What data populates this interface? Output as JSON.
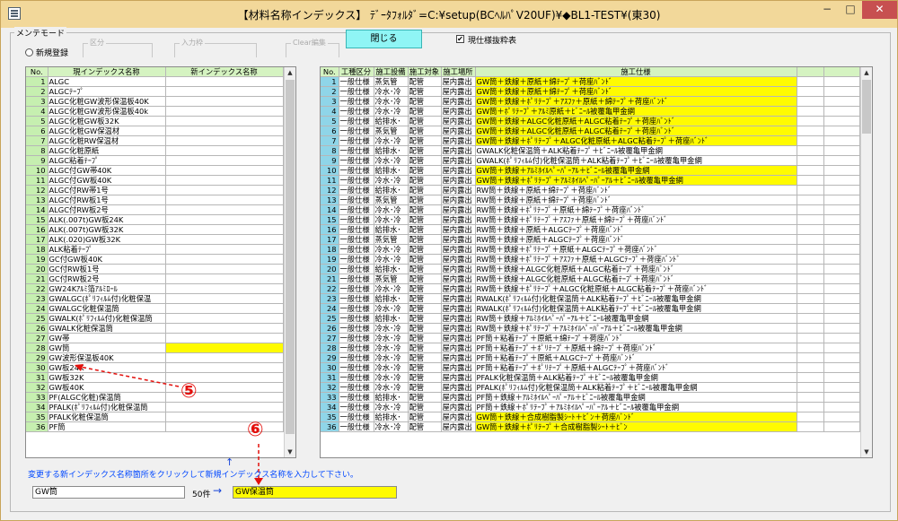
{
  "window": {
    "title": "【材料名称インデックス】 ﾃﾞｰﾀﾌｫﾙﾀﾞ=C:¥setup(BCﾍﾙﾊﾟV20UF)¥◆BL1-TEST¥(東30)",
    "min": "−",
    "max": "□",
    "close": "✕"
  },
  "mode": {
    "legend": "メンテモード",
    "new_label": "新規登録",
    "section_label": "区分",
    "input_label": "入力枠",
    "clear_label": "Clear編集"
  },
  "toolbar": {
    "close_label": "閉じる",
    "checkbox_label": "現仕様抜粋表",
    "checkbox_checked": "✔"
  },
  "left_table": {
    "headers": [
      "No.",
      "現インデックス名称",
      "新インデックス名称"
    ],
    "rows": [
      {
        "no": "1",
        "name": "ALGC"
      },
      {
        "no": "2",
        "name": "ALGCﾃｰﾌﾟ"
      },
      {
        "no": "3",
        "name": "ALGC化粧GW波形保温板40K"
      },
      {
        "no": "4",
        "name": "ALGC化粧GW波形保温板40k"
      },
      {
        "no": "5",
        "name": "ALGC化粧GW板32K"
      },
      {
        "no": "6",
        "name": "ALGC化粧GW保温材"
      },
      {
        "no": "7",
        "name": "ALGC化粧RW保温材"
      },
      {
        "no": "8",
        "name": "ALGC化粧原紙"
      },
      {
        "no": "9",
        "name": "ALGC粘着ﾃｰﾌﾟ"
      },
      {
        "no": "10",
        "name": "ALGC付GW帯40K"
      },
      {
        "no": "11",
        "name": "ALGC付GW板40K"
      },
      {
        "no": "12",
        "name": "ALGC付RW帯1号"
      },
      {
        "no": "13",
        "name": "ALGC付RW板1号"
      },
      {
        "no": "14",
        "name": "ALGC付RW板2号"
      },
      {
        "no": "15",
        "name": "ALK(.007t)GW板24K"
      },
      {
        "no": "16",
        "name": "ALK(.007t)GW板32K"
      },
      {
        "no": "17",
        "name": "ALK(.020)GW板32K"
      },
      {
        "no": "18",
        "name": "ALK粘着ﾃｰﾌﾟ"
      },
      {
        "no": "19",
        "name": "GC付GW板40K"
      },
      {
        "no": "20",
        "name": "GC付RW板1号"
      },
      {
        "no": "21",
        "name": "GC付RW板2号"
      },
      {
        "no": "22",
        "name": "GW24Kｱﾙﾐ箔ｱﾙﾐﾛｰﾙ"
      },
      {
        "no": "23",
        "name": "GWALGC(ﾎﾟﾘﾌｨﾙﾑ付)化粧保温"
      },
      {
        "no": "24",
        "name": "GWALGC化粧保温筒"
      },
      {
        "no": "25",
        "name": "GWALK(ﾎﾟﾘﾌｨﾙﾑ付)化粧保温筒"
      },
      {
        "no": "26",
        "name": "GWALK化粧保温筒"
      },
      {
        "no": "27",
        "name": "GW帯"
      },
      {
        "no": "28",
        "name": "GW筒"
      },
      {
        "no": "29",
        "name": "GW波形保温板40K"
      },
      {
        "no": "30",
        "name": "GW板24K"
      },
      {
        "no": "31",
        "name": "GW板32K"
      },
      {
        "no": "32",
        "name": "GW板40K"
      },
      {
        "no": "33",
        "name": "PF(ALGC化粧)保温筒"
      },
      {
        "no": "34",
        "name": "PFALK(ﾎﾟﾘﾌｨﾙﾑ付)化粧保温筒"
      },
      {
        "no": "35",
        "name": "PFALK化粧保温筒"
      },
      {
        "no": "36",
        "name": "PF筒"
      }
    ]
  },
  "right_table": {
    "headers": [
      "No.",
      "工種区分",
      "施工設備",
      "施工対象",
      "施工場所",
      "施工仕様"
    ],
    "rows": [
      {
        "no": "1",
        "a": "一般仕様",
        "b": "蒸気管",
        "c": "配管",
        "d": "屋内露出",
        "e": "GW筒＋鉄線＋原紙＋綿ﾃｰﾌﾟ＋荷座ﾊﾞﾝﾄﾞ",
        "hl": true
      },
      {
        "no": "2",
        "a": "一般仕様",
        "b": "冷水･冷",
        "c": "配管",
        "d": "屋内露出",
        "e": "GW筒＋鉄線＋原紙＋綿ﾃｰﾌﾟ＋荷座ﾊﾞﾝﾄﾞ",
        "hl": true
      },
      {
        "no": "3",
        "a": "一般仕様",
        "b": "冷水･冷",
        "c": "配管",
        "d": "屋内露出",
        "e": "GW筒＋鉄線＋ﾎﾟﾘﾃｰﾌﾟ＋ｱｽﾌｧ＋原紙＋綿ﾃｰﾌﾟ＋荷座ﾊﾞﾝﾄﾞ",
        "hl": true
      },
      {
        "no": "4",
        "a": "一般仕様",
        "b": "冷水･冷",
        "c": "配管",
        "d": "屋内露出",
        "e": "GW筒＋ﾎﾟﾘﾃｰﾌﾟ＋ｱﾙﾐ原紙＋ﾋﾞﾆｰﾙ被覆亀甲金網",
        "hl": true
      },
      {
        "no": "5",
        "a": "一般仕様",
        "b": "給排水･",
        "c": "配管",
        "d": "屋内露出",
        "e": "GW筒＋鉄線＋ALGC化粧原紙＋ALGC粘着ﾃｰﾌﾟ＋荷座ﾊﾞﾝﾄﾞ",
        "hl": true
      },
      {
        "no": "6",
        "a": "一般仕様",
        "b": "蒸気管",
        "c": "配管",
        "d": "屋内露出",
        "e": "GW筒＋鉄線＋ALGC化粧原紙＋ALGC粘着ﾃｰﾌﾟ＋荷座ﾊﾞﾝﾄﾞ",
        "hl": true
      },
      {
        "no": "7",
        "a": "一般仕様",
        "b": "冷水･冷",
        "c": "配管",
        "d": "屋内露出",
        "e": "GW筒＋鉄線＋ﾎﾟﾘﾃｰﾌﾟ＋ALGC化粧原紙＋ALGC粘着ﾃｰﾌﾟ＋荷座ﾊﾞﾝﾄﾞ",
        "hl": true
      },
      {
        "no": "8",
        "a": "一般仕様",
        "b": "給排水･",
        "c": "配管",
        "d": "屋内露出",
        "e": "GWALK化粧保温筒＋ALK粘着ﾃｰﾌﾟ＋ﾋﾞﾆｰﾙ被覆亀甲金網",
        "hl": false
      },
      {
        "no": "9",
        "a": "一般仕様",
        "b": "冷水･冷",
        "c": "配管",
        "d": "屋内露出",
        "e": "GWALK(ﾎﾟﾘﾌｨﾙﾑ付)化粧保温筒＋ALK粘着ﾃｰﾌﾟ＋ﾋﾞﾆｰﾙ被覆亀甲金網",
        "hl": false
      },
      {
        "no": "10",
        "a": "一般仕様",
        "b": "給排水･",
        "c": "配管",
        "d": "屋内露出",
        "e": "GW筒＋鉄線＋ｱﾙﾐﾎｲﾙﾍﾟｰﾊﾟｰｱﾙ＋ﾋﾞﾆｰﾙ被覆亀甲金網",
        "hl": true
      },
      {
        "no": "11",
        "a": "一般仕様",
        "b": "冷水･冷",
        "c": "配管",
        "d": "屋内露出",
        "e": "GW筒＋鉄線＋ﾎﾟﾘﾃｰﾌﾟ＋ｱﾙﾐﾎｲﾙﾍﾟｰﾊﾟｰｱﾙ＋ﾋﾞﾆｰﾙ被覆亀甲金網",
        "hl": true
      },
      {
        "no": "12",
        "a": "一般仕様",
        "b": "給排水･",
        "c": "配管",
        "d": "屋内露出",
        "e": "RW筒＋鉄線＋原紙＋綿ﾃｰﾌﾟ＋荷座ﾊﾞﾝﾄﾞ",
        "hl": false
      },
      {
        "no": "13",
        "a": "一般仕様",
        "b": "蒸気管",
        "c": "配管",
        "d": "屋内露出",
        "e": "RW筒＋鉄線＋原紙＋綿ﾃｰﾌﾟ＋荷座ﾊﾞﾝﾄﾞ",
        "hl": false
      },
      {
        "no": "14",
        "a": "一般仕様",
        "b": "冷水･冷",
        "c": "配管",
        "d": "屋内露出",
        "e": "RW筒＋鉄線＋ﾎﾟﾘﾃｰﾌﾟ＋原紙＋綿ﾃｰﾌﾟ＋荷座ﾊﾞﾝﾄﾞ",
        "hl": false
      },
      {
        "no": "15",
        "a": "一般仕様",
        "b": "冷水･冷",
        "c": "配管",
        "d": "屋内露出",
        "e": "RW筒＋鉄線＋ﾎﾟﾘﾃｰﾌﾟ＋ｱｽﾌｧ＋原紙＋綿ﾃｰﾌﾟ＋荷座ﾊﾞﾝﾄﾞ",
        "hl": false
      },
      {
        "no": "16",
        "a": "一般仕様",
        "b": "給排水･",
        "c": "配管",
        "d": "屋内露出",
        "e": "RW筒＋鉄線＋原紙＋ALGCﾃｰﾌﾟ＋荷座ﾊﾞﾝﾄﾞ",
        "hl": false
      },
      {
        "no": "17",
        "a": "一般仕様",
        "b": "蒸気管",
        "c": "配管",
        "d": "屋内露出",
        "e": "RW筒＋鉄線＋原紙＋ALGCﾃｰﾌﾟ＋荷座ﾊﾞﾝﾄﾞ",
        "hl": false
      },
      {
        "no": "18",
        "a": "一般仕様",
        "b": "冷水･冷",
        "c": "配管",
        "d": "屋内露出",
        "e": "RW筒＋鉄線＋ﾎﾟﾘﾃｰﾌﾟ＋原紙＋ALGCﾃｰﾌﾟ＋荷座ﾊﾞﾝﾄﾞ",
        "hl": false
      },
      {
        "no": "19",
        "a": "一般仕様",
        "b": "冷水･冷",
        "c": "配管",
        "d": "屋内露出",
        "e": "RW筒＋鉄線＋ﾎﾟﾘﾃｰﾌﾟ＋ｱｽﾌｧ＋原紙＋ALGCﾃｰﾌﾟ＋荷座ﾊﾞﾝﾄﾞ",
        "hl": false
      },
      {
        "no": "20",
        "a": "一般仕様",
        "b": "給排水･",
        "c": "配管",
        "d": "屋内露出",
        "e": "RW筒＋鉄線＋ALGC化粧原紙＋ALGC粘着ﾃｰﾌﾟ＋荷座ﾊﾞﾝﾄﾞ",
        "hl": false
      },
      {
        "no": "21",
        "a": "一般仕様",
        "b": "蒸気管",
        "c": "配管",
        "d": "屋内露出",
        "e": "RW筒＋鉄線＋ALGC化粧原紙＋ALGC粘着ﾃｰﾌﾟ＋荷座ﾊﾞﾝﾄﾞ",
        "hl": false
      },
      {
        "no": "22",
        "a": "一般仕様",
        "b": "冷水･冷",
        "c": "配管",
        "d": "屋内露出",
        "e": "RW筒＋鉄線＋ﾎﾟﾘﾃｰﾌﾟ＋ALGC化粧原紙＋ALGC粘着ﾃｰﾌﾟ＋荷座ﾊﾞﾝﾄﾞ",
        "hl": false
      },
      {
        "no": "23",
        "a": "一般仕様",
        "b": "給排水･",
        "c": "配管",
        "d": "屋内露出",
        "e": "RWALK(ﾎﾟﾘﾌｨﾙﾑ付)化粧保温筒＋ALK粘着ﾃｰﾌﾟ＋ﾋﾞﾆｰﾙ被覆亀甲金網",
        "hl": false
      },
      {
        "no": "24",
        "a": "一般仕様",
        "b": "冷水･冷",
        "c": "配管",
        "d": "屋内露出",
        "e": "RWALK(ﾎﾟﾘﾌｨﾙﾑ付)化粧保温筒＋ALK粘着ﾃｰﾌﾟ＋ﾋﾞﾆｰﾙ被覆亀甲金網",
        "hl": false
      },
      {
        "no": "25",
        "a": "一般仕様",
        "b": "給排水･",
        "c": "配管",
        "d": "屋内露出",
        "e": "RW筒＋鉄線＋ｱﾙﾐﾎｲﾙﾍﾟｰﾊﾟｰｱﾙ＋ﾋﾞﾆｰﾙ被覆亀甲金網",
        "hl": false
      },
      {
        "no": "26",
        "a": "一般仕様",
        "b": "冷水･冷",
        "c": "配管",
        "d": "屋内露出",
        "e": "RW筒＋鉄線＋ﾎﾟﾘﾃｰﾌﾟ＋ｱﾙﾐﾎｲﾙﾍﾟｰﾊﾟｰｱﾙ＋ﾋﾞﾆｰﾙ被覆亀甲金網",
        "hl": false
      },
      {
        "no": "27",
        "a": "一般仕様",
        "b": "冷水･冷",
        "c": "配管",
        "d": "屋内露出",
        "e": "PF筒＋粘着ﾃｰﾌﾟ＋原紙＋綿ﾃｰﾌﾟ＋荷座ﾊﾞﾝﾄﾞ",
        "hl": false
      },
      {
        "no": "28",
        "a": "一般仕様",
        "b": "冷水･冷",
        "c": "配管",
        "d": "屋内露出",
        "e": "PF筒＋粘着ﾃｰﾌﾟ＋ﾎﾟﾘﾃｰﾌﾟ＋原紙＋綿ﾃｰﾌﾟ＋荷座ﾊﾞﾝﾄﾞ",
        "hl": false
      },
      {
        "no": "29",
        "a": "一般仕様",
        "b": "冷水･冷",
        "c": "配管",
        "d": "屋内露出",
        "e": "PF筒＋粘着ﾃｰﾌﾟ＋原紙＋ALGCﾃｰﾌﾟ＋荷座ﾊﾞﾝﾄﾞ",
        "hl": false
      },
      {
        "no": "30",
        "a": "一般仕様",
        "b": "冷水･冷",
        "c": "配管",
        "d": "屋内露出",
        "e": "PF筒＋粘着ﾃｰﾌﾟ＋ﾎﾟﾘﾃｰﾌﾟ＋原紙＋ALGCﾃｰﾌﾟ＋荷座ﾊﾞﾝﾄﾞ",
        "hl": false
      },
      {
        "no": "31",
        "a": "一般仕様",
        "b": "冷水･冷",
        "c": "配管",
        "d": "屋内露出",
        "e": "PFALK化粧保温筒＋ALK粘着ﾃｰﾌﾟ＋ﾋﾞﾆｰﾙ被覆亀甲金網",
        "hl": false
      },
      {
        "no": "32",
        "a": "一般仕様",
        "b": "冷水･冷",
        "c": "配管",
        "d": "屋内露出",
        "e": "PFALK(ﾎﾟﾘﾌｨﾙﾑ付)化粧保温筒＋ALK粘着ﾃｰﾌﾟ＋ﾋﾞﾆｰﾙ被覆亀甲金網",
        "hl": false
      },
      {
        "no": "33",
        "a": "一般仕様",
        "b": "給排水･",
        "c": "配管",
        "d": "屋内露出",
        "e": "PF筒＋鉄線＋ｱﾙﾐﾎｲﾙﾍﾟｰﾊﾟｰｱﾙ＋ﾋﾞﾆｰﾙ被覆亀甲金網",
        "hl": false
      },
      {
        "no": "34",
        "a": "一般仕様",
        "b": "冷水･冷",
        "c": "配管",
        "d": "屋内露出",
        "e": "PF筒＋鉄線＋ﾎﾟﾘﾃｰﾌﾟ＋ｱﾙﾐﾎｲﾙﾍﾟｰﾊﾟｰｱﾙ＋ﾋﾞﾆｰﾙ被覆亀甲金網",
        "hl": false
      },
      {
        "no": "35",
        "a": "一般仕様",
        "b": "給排水･",
        "c": "配管",
        "d": "屋内露出",
        "e": "GW筒＋鉄線＋合成樹脂製ｼｰﾄ＋ﾋﾞﾝ＋荷座ﾊﾞﾝﾄﾞ",
        "hl": true
      },
      {
        "no": "36",
        "a": "一般仕様",
        "b": "冷水･冷",
        "c": "配管",
        "d": "屋内露出",
        "e": "GW筒＋鉄線＋ﾎﾟﾘﾃｰﾌﾟ＋合成樹脂製ｼｰﾄ＋ﾋﾞﾝ",
        "hl": true
      }
    ]
  },
  "bottom": {
    "hint": "変更する新インデックス名称箇所をクリックして新規インデックス名称を入力して下さい。",
    "current_value": "GW筒",
    "count": "50件",
    "new_value": "GW保温筒",
    "arrow": "→",
    "up_arrow": "↑"
  },
  "annotations": {
    "five": "⑤",
    "six": "⑥"
  },
  "colors": {
    "highlight": "#fffb00",
    "header_bg": "#d5f3c1",
    "rownum_bg": "#8fd5e8",
    "annotation": "#e3100c",
    "close_btn": "#8ff5f5"
  }
}
